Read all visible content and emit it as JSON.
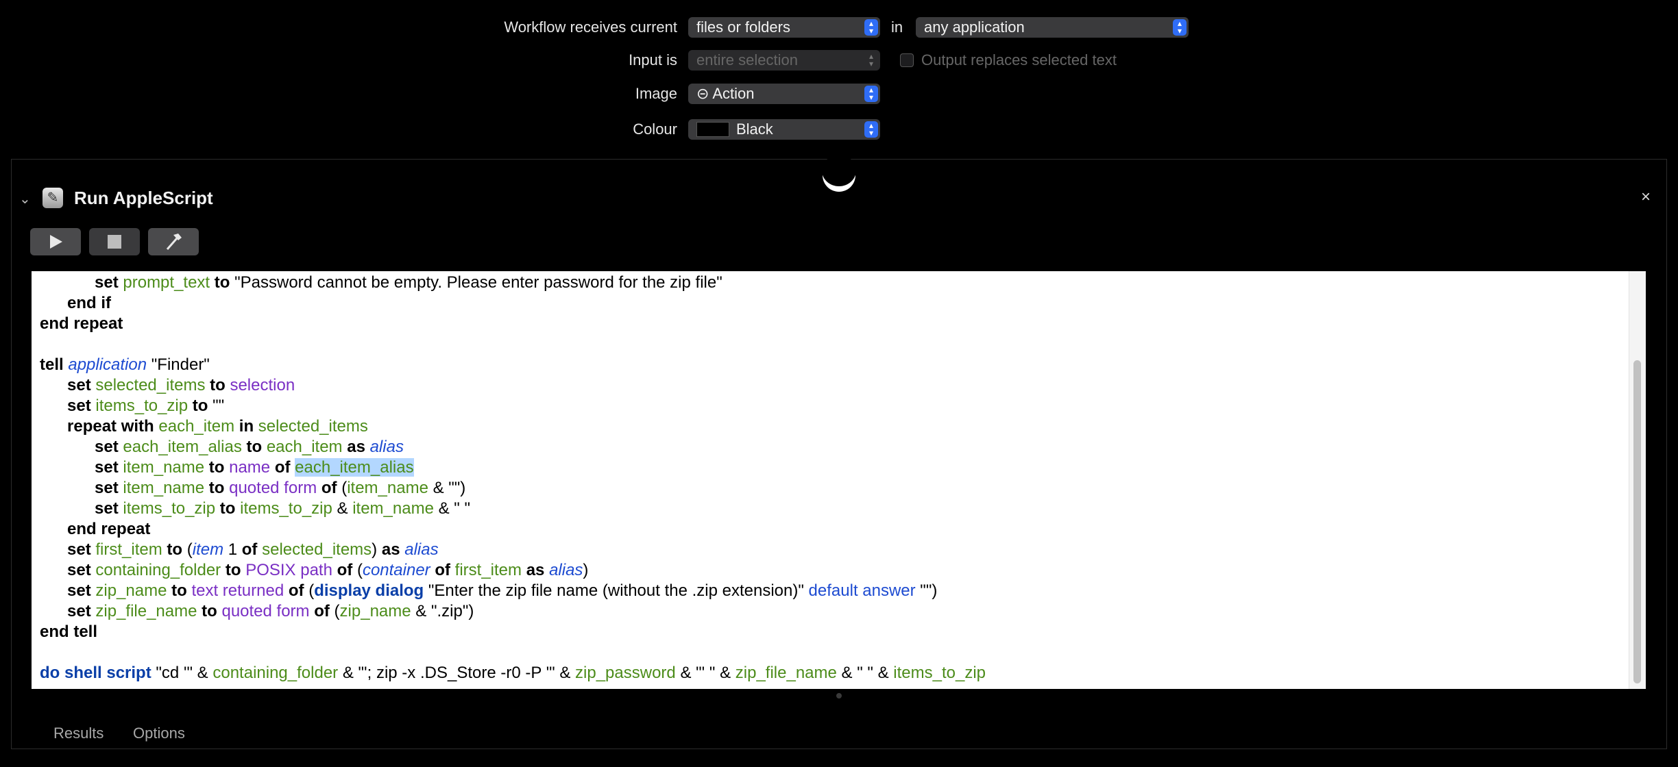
{
  "settings": {
    "receives_label": "Workflow receives current",
    "receives_value": "files or folders",
    "in_label": "in",
    "app_value": "any application",
    "input_label": "Input is",
    "input_value": "entire selection",
    "output_replaces_label": "Output replaces selected text",
    "image_label": "Image",
    "image_value": "⊝ Action",
    "colour_label": "Colour",
    "colour_value": "Black"
  },
  "action": {
    "title": "Run AppleScript",
    "close_icon": "×",
    "collapse_icon": "chevron-down-icon"
  },
  "tabs": {
    "results": "Results",
    "options": "Options"
  },
  "code_lines": [
    [
      {
        "t": "            "
      },
      {
        "t": "set ",
        "c": "kw"
      },
      {
        "t": "prompt_text",
        "c": "var"
      },
      {
        "t": " to ",
        "c": "kw"
      },
      {
        "t": "\"Password cannot be empty. Please enter password for the zip file\""
      }
    ],
    [
      {
        "t": "      "
      },
      {
        "t": "end if",
        "c": "kw"
      }
    ],
    [
      {
        "t": "end repeat",
        "c": "kw"
      }
    ],
    [
      {
        "t": ""
      }
    ],
    [
      {
        "t": "tell ",
        "c": "kw"
      },
      {
        "t": "application",
        "c": "cls"
      },
      {
        "t": " \"Finder\""
      }
    ],
    [
      {
        "t": "      "
      },
      {
        "t": "set ",
        "c": "kw"
      },
      {
        "t": "selected_items",
        "c": "var"
      },
      {
        "t": " to ",
        "c": "kw"
      },
      {
        "t": "selection",
        "c": "prop"
      }
    ],
    [
      {
        "t": "      "
      },
      {
        "t": "set ",
        "c": "kw"
      },
      {
        "t": "items_to_zip",
        "c": "var"
      },
      {
        "t": " to ",
        "c": "kw"
      },
      {
        "t": "\"\""
      }
    ],
    [
      {
        "t": "      "
      },
      {
        "t": "repeat with ",
        "c": "kw"
      },
      {
        "t": "each_item",
        "c": "var"
      },
      {
        "t": " in ",
        "c": "kw"
      },
      {
        "t": "selected_items",
        "c": "var"
      }
    ],
    [
      {
        "t": "            "
      },
      {
        "t": "set ",
        "c": "kw"
      },
      {
        "t": "each_item_alias",
        "c": "var"
      },
      {
        "t": " to ",
        "c": "kw"
      },
      {
        "t": "each_item",
        "c": "var"
      },
      {
        "t": " as ",
        "c": "kw"
      },
      {
        "t": "alias",
        "c": "cls"
      }
    ],
    [
      {
        "t": "            "
      },
      {
        "t": "set ",
        "c": "kw"
      },
      {
        "t": "item_name",
        "c": "var"
      },
      {
        "t": " to ",
        "c": "kw"
      },
      {
        "t": "name",
        "c": "prop"
      },
      {
        "t": " of ",
        "c": "kw"
      },
      {
        "t": "each_item_alias",
        "c": "var hl"
      }
    ],
    [
      {
        "t": "            "
      },
      {
        "t": "set ",
        "c": "kw"
      },
      {
        "t": "item_name",
        "c": "var"
      },
      {
        "t": " to ",
        "c": "kw"
      },
      {
        "t": "quoted form",
        "c": "prop"
      },
      {
        "t": " of ",
        "c": "kw"
      },
      {
        "t": "("
      },
      {
        "t": "item_name",
        "c": "var"
      },
      {
        "t": " & \"\")"
      }
    ],
    [
      {
        "t": "            "
      },
      {
        "t": "set ",
        "c": "kw"
      },
      {
        "t": "items_to_zip",
        "c": "var"
      },
      {
        "t": " to ",
        "c": "kw"
      },
      {
        "t": "items_to_zip",
        "c": "var"
      },
      {
        "t": " & "
      },
      {
        "t": "item_name",
        "c": "var"
      },
      {
        "t": " & \" \""
      }
    ],
    [
      {
        "t": "      "
      },
      {
        "t": "end repeat",
        "c": "kw"
      }
    ],
    [
      {
        "t": "      "
      },
      {
        "t": "set ",
        "c": "kw"
      },
      {
        "t": "first_item",
        "c": "var"
      },
      {
        "t": " to ",
        "c": "kw"
      },
      {
        "t": "("
      },
      {
        "t": "item",
        "c": "cls"
      },
      {
        "t": " 1 "
      },
      {
        "t": "of ",
        "c": "kw"
      },
      {
        "t": "selected_items",
        "c": "var"
      },
      {
        "t": ") "
      },
      {
        "t": "as ",
        "c": "kw"
      },
      {
        "t": "alias",
        "c": "cls"
      }
    ],
    [
      {
        "t": "      "
      },
      {
        "t": "set ",
        "c": "kw"
      },
      {
        "t": "containing_folder",
        "c": "var"
      },
      {
        "t": " to ",
        "c": "kw"
      },
      {
        "t": "POSIX path",
        "c": "prop"
      },
      {
        "t": " of ",
        "c": "kw"
      },
      {
        "t": "("
      },
      {
        "t": "container",
        "c": "cls"
      },
      {
        "t": " of ",
        "c": "kw"
      },
      {
        "t": "first_item",
        "c": "var"
      },
      {
        "t": " as ",
        "c": "kw"
      },
      {
        "t": "alias",
        "c": "cls"
      },
      {
        "t": ")"
      }
    ],
    [
      {
        "t": "      "
      },
      {
        "t": "set ",
        "c": "kw"
      },
      {
        "t": "zip_name",
        "c": "var"
      },
      {
        "t": " to ",
        "c": "kw"
      },
      {
        "t": "text returned",
        "c": "prop"
      },
      {
        "t": " of ",
        "c": "kw"
      },
      {
        "t": "("
      },
      {
        "t": "display dialog",
        "c": "kwb"
      },
      {
        "t": " \"Enter the zip file name (without the .zip extension)\" "
      },
      {
        "t": "default answer",
        "c": "cmd"
      },
      {
        "t": " \"\")"
      }
    ],
    [
      {
        "t": "      "
      },
      {
        "t": "set ",
        "c": "kw"
      },
      {
        "t": "zip_file_name",
        "c": "var"
      },
      {
        "t": " to ",
        "c": "kw"
      },
      {
        "t": "quoted form",
        "c": "prop"
      },
      {
        "t": " of ",
        "c": "kw"
      },
      {
        "t": "("
      },
      {
        "t": "zip_name",
        "c": "var"
      },
      {
        "t": " & \".zip\")"
      }
    ],
    [
      {
        "t": "end tell",
        "c": "kw"
      }
    ],
    [
      {
        "t": ""
      }
    ],
    [
      {
        "t": "do shell script",
        "c": "kwb"
      },
      {
        "t": " \"cd '\" & "
      },
      {
        "t": "containing_folder",
        "c": "var"
      },
      {
        "t": " & \"'; zip -x .DS_Store -r0 -P '\" & "
      },
      {
        "t": "zip_password",
        "c": "var"
      },
      {
        "t": " & \"' \" & "
      },
      {
        "t": "zip_file_name",
        "c": "var"
      },
      {
        "t": " & \" \" & "
      },
      {
        "t": "items_to_zip",
        "c": "var"
      }
    ]
  ]
}
